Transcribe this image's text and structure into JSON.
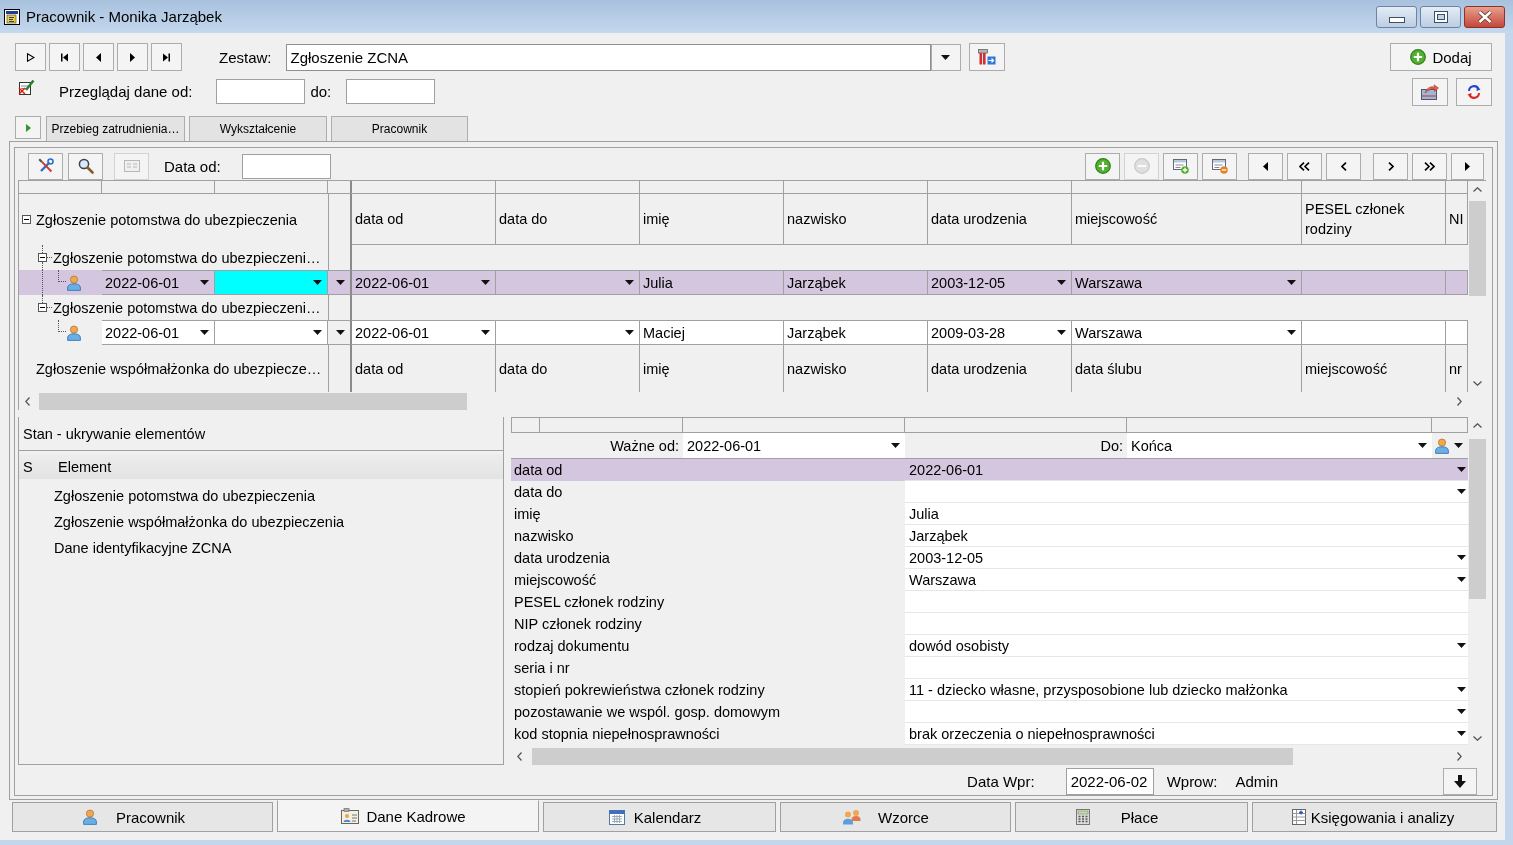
{
  "window": {
    "title": "Pracownik - Monika Jarząbek"
  },
  "record_nav": {
    "set_label": "Zestaw:",
    "set_value": "Zgłoszenie ZCNA",
    "add_button": "Dodaj"
  },
  "date_filter": {
    "from_label": "Przeglądaj dane od:",
    "to_label": "do:"
  },
  "tabs": [
    {
      "label": "Przebieg zatrudnienia…",
      "selected": false
    },
    {
      "label": "Wykształcenie",
      "selected": false
    },
    {
      "label": "Pracownik",
      "selected": false
    }
  ],
  "grid_toolbar": {
    "view_buttons": [
      {
        "disabled": false
      },
      {
        "disabled": false
      },
      {
        "disabled": true
      }
    ],
    "date_label": "Data od:",
    "edit_buttons": [
      {
        "disabled": false
      },
      {
        "disabled": true
      },
      {
        "disabled": false
      },
      {
        "disabled": false
      }
    ]
  },
  "grid": {
    "groups": [
      {
        "title": "Zgłoszenie potomstwa do ubezpieczenia",
        "expanded": true,
        "columns": [
          "data od",
          "data do",
          "imię",
          "nazwisko",
          "data urodzenia",
          "miejscowość",
          "PESEL członek rodziny",
          "NI"
        ],
        "children": [
          {
            "title": "Zgłoszenie potomstwa do ubezpieczeni…",
            "expanded": true,
            "records": [
              {
                "selected": true,
                "key_cells": [
                  {
                    "value": "2022-06-01",
                    "dropdown": true,
                    "focused": false
                  },
                  {
                    "dropdown": true,
                    "focused": true
                  },
                  {
                    "dropdown": true,
                    "focused": false
                  }
                ],
                "cells": [
                  {
                    "value": "2022-06-01",
                    "dropdown": true
                  },
                  {
                    "dropdown": true
                  },
                  {
                    "value": "Julia",
                    "dropdown": false
                  },
                  {
                    "value": "Jarząbek",
                    "dropdown": false
                  },
                  {
                    "value": "2003-12-05",
                    "dropdown": true
                  },
                  {
                    "value": "Warszawa",
                    "dropdown": true
                  },
                  {
                    "dropdown": false
                  },
                  {
                    "dropdown": false
                  }
                ]
              }
            ]
          },
          {
            "title": "Zgłoszenie potomstwa do ubezpieczeni…",
            "expanded": true,
            "records": [
              {
                "selected": false,
                "key_cells": [
                  {
                    "value": "2022-06-01",
                    "dropdown": true,
                    "focused": false
                  },
                  {
                    "dropdown": true,
                    "focused": false
                  },
                  {
                    "dropdown": true,
                    "focused": false
                  }
                ],
                "cells": [
                  {
                    "value": "2022-06-01",
                    "dropdown": true
                  },
                  {
                    "dropdown": true
                  },
                  {
                    "value": "Maciej",
                    "dropdown": false
                  },
                  {
                    "value": "Jarząbek",
                    "dropdown": false
                  },
                  {
                    "value": "2009-03-28",
                    "dropdown": true
                  },
                  {
                    "value": "Warszawa",
                    "dropdown": true
                  },
                  {
                    "dropdown": false
                  },
                  {
                    "dropdown": false
                  }
                ]
              }
            ]
          }
        ]
      },
      {
        "title": "Zgłoszenie współmałżonka do ubezpiecze…",
        "columns": [
          "data od",
          "data do",
          "imię",
          "nazwisko",
          "data urodzenia",
          "data ślubu",
          "miejscowość",
          "nr"
        ]
      }
    ]
  },
  "hidden_elements": {
    "title": "Stan - ukrywanie elementów",
    "columns": [
      "S",
      "Element"
    ],
    "items": [
      "Zgłoszenie potomstwa do ubezpieczenia",
      "Zgłoszenie współmałżonka do ubezpieczenia",
      "Dane identyfikacyjne ZCNA"
    ]
  },
  "properties": {
    "valid_from_label": "Ważne od:",
    "valid_from": "2022-06-01",
    "to_label": "Do:",
    "to": "Końca",
    "rows": [
      {
        "label": "data od",
        "value": "2022-06-01",
        "dropdown": true,
        "selected": true
      },
      {
        "label": "data do",
        "dropdown": true,
        "selected": false
      },
      {
        "label": "imię",
        "value": "Julia",
        "dropdown": false,
        "selected": false
      },
      {
        "label": "nazwisko",
        "value": "Jarząbek",
        "dropdown": false,
        "selected": false
      },
      {
        "label": "data urodzenia",
        "value": "2003-12-05",
        "dropdown": true,
        "selected": false
      },
      {
        "label": "miejscowość",
        "value": "Warszawa",
        "dropdown": true,
        "selected": false
      },
      {
        "label": "PESEL członek rodziny",
        "dropdown": false,
        "selected": false
      },
      {
        "label": "NIP członek rodziny",
        "dropdown": false,
        "selected": false
      },
      {
        "label": "rodzaj dokumentu",
        "value": "dowód osobisty",
        "dropdown": true,
        "selected": false
      },
      {
        "label": "seria i nr",
        "dropdown": false,
        "selected": false
      },
      {
        "label": "stopień pokrewieństwa członek rodziny",
        "value": "11 - dziecko własne, przysposobione lub dziecko małżonka",
        "dropdown": true,
        "selected": false
      },
      {
        "label": "pozostawanie we wspól. gosp. domowym",
        "dropdown": true,
        "selected": false
      },
      {
        "label": "kod stopnia niepełnosprawności",
        "value": "brak orzeczenia o niepełnosprawności",
        "dropdown": true,
        "selected": false
      }
    ]
  },
  "entry_info": {
    "date_label": "Data Wpr:",
    "date": "2022-06-02",
    "user_label": "Wprow:",
    "user": "Admin"
  },
  "module_tabs": [
    {
      "label": "Pracownik",
      "selected": false
    },
    {
      "label": "Dane Kadrowe",
      "selected": true
    },
    {
      "label": "Kalendarz",
      "selected": false
    },
    {
      "label": "Wzorce",
      "selected": false
    },
    {
      "label": "Płace",
      "selected": false
    },
    {
      "label": "Księgowania i analizy",
      "selected": false
    }
  ]
}
